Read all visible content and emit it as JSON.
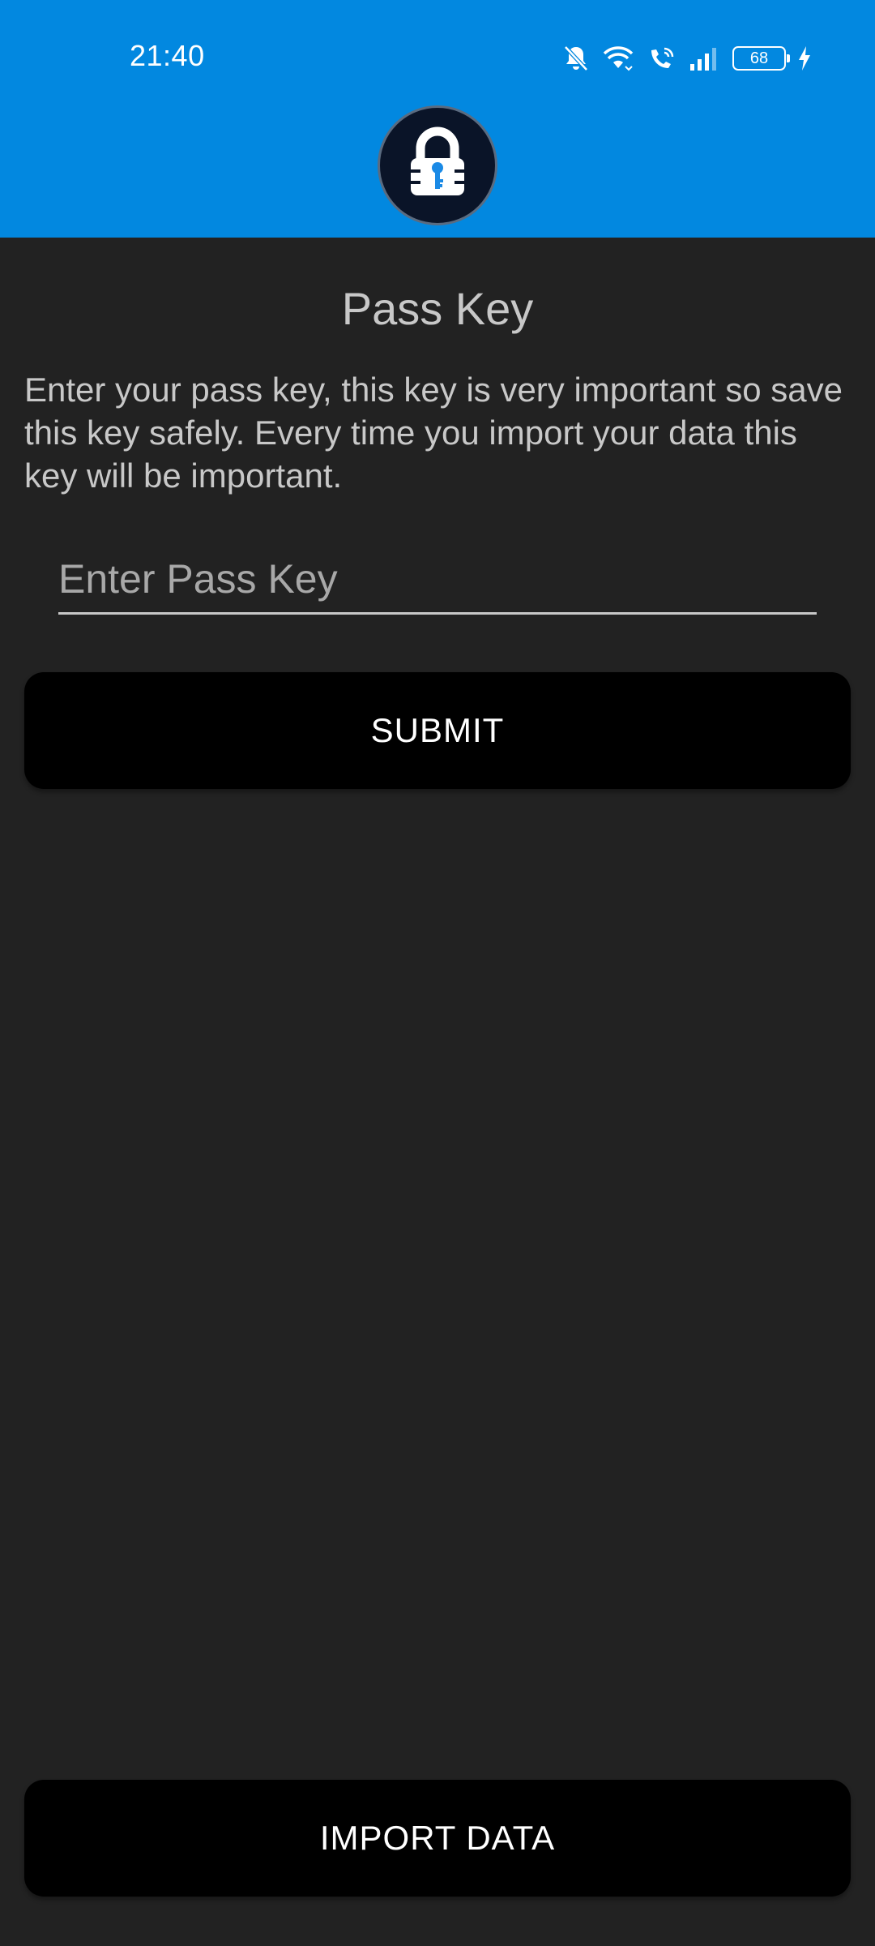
{
  "status_bar": {
    "time": "21:40",
    "battery_level": "68",
    "icons": [
      "bell-off-icon",
      "wifi-icon",
      "wifi-calling-icon",
      "signal-icon",
      "battery-icon",
      "charging-icon"
    ]
  },
  "header": {
    "logo_icon": "padlock-key-icon",
    "background_color": "#0288e0"
  },
  "main": {
    "title": "Pass Key",
    "description": "Enter your pass key, this key is very important so save this key safely. Every time you import your data this key will be important.",
    "passkey_input": {
      "value": "",
      "placeholder": "Enter Pass Key"
    },
    "submit_label": "SUBMIT"
  },
  "footer": {
    "import_label": "IMPORT DATA"
  },
  "colors": {
    "accent": "#0288e0",
    "background": "#222222",
    "button": "#000000",
    "text": "#c8c8c8"
  }
}
